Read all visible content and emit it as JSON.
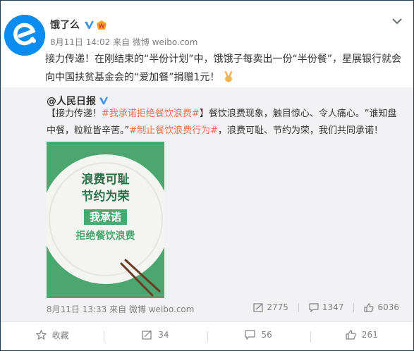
{
  "post": {
    "author": "饿了么",
    "meta": "8月11日 14:02 来自 微博 weibo.com",
    "text": "接力传递！在刚结束的“半份计划”中，饿饿子每卖出一份“半份餐”，星展银行就会向中国扶贫基金会的“爱加餐”捐赠1元！",
    "icons": {
      "avatar": "eleme-logo",
      "verified": "verified-v-icon",
      "badge": "member-badge-icon",
      "more": "chevron-down-icon",
      "emoji": "victory-hand-emoji"
    }
  },
  "repost": {
    "author": "@人民日报",
    "text_parts": {
      "p1": "【接力传递！",
      "tag1": "#我承诺拒绝餐饮浪费#",
      "p2": "】餐饮浪费现象，触目惊心、令人痛心。“谁知盘中餐，粒粒皆辛苦。”",
      "tag2": "#制止餐饮浪费行为#",
      "p3": "，浪费可耻、节约为荣，我们共同承诺！"
    },
    "poster": {
      "line1": "浪费可耻",
      "line2": "节约为荣",
      "pill": "我承诺",
      "line3": "拒绝餐饮浪费",
      "colors": {
        "background": "#4ca66f",
        "plate": "#f4f4f0",
        "text": "#2f6e4a"
      }
    },
    "meta": "8月11日 13:33 来自 微博 weibo.com",
    "stats": {
      "reposts": "2775",
      "comments": "1347",
      "likes": "6036"
    }
  },
  "actions": {
    "favorite": "收藏",
    "repost": "34",
    "comment": "56",
    "like": "261"
  },
  "colors": {
    "accent": "#eb7350",
    "brand_blue": "#0a8cf0",
    "repost_bg": "#f2f2f5"
  }
}
